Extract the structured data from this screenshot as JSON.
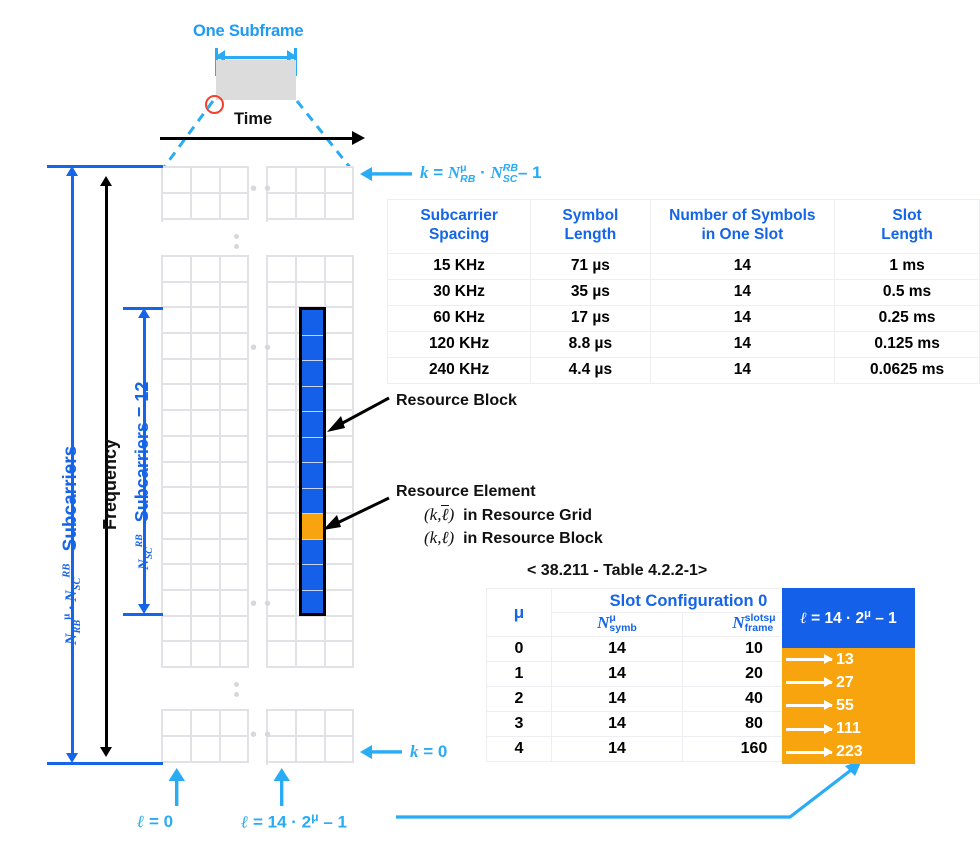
{
  "title": "5G NR Resource Grid / Resource Block / Resource Element diagram",
  "callout": {
    "one_subframe": "One Subframe",
    "time_axis_label": "Time",
    "marker": "red-circle-marker"
  },
  "axes": {
    "frequency_label": "Frequency",
    "k_top_label": "k = Nᴿᴮᵁ · Nₛᴄᴿᴮ – 1",
    "k_top_parts": {
      "lhs": "k = ",
      "n1": "N",
      "n1_sup": "μ",
      "n1_sub": "RB",
      "dot": "·",
      "n2": "N",
      "n2_sup": "RB",
      "n2_sub": "SC",
      "tail": "– 1"
    },
    "k_bottom_label": "k = 0",
    "l_left_label": "ℓ = 0",
    "l_right_label": "ℓ = 14 · 2μ – 1",
    "l_right_parts": {
      "lhs": "ℓ = 14 · 2",
      "sup": "μ",
      "tail": "– 1"
    },
    "total_subcarriers_label": "Subcarriers",
    "total_subcarriers_prefix": "Nᴿᴮᵁ · Nₛᴄᴿᴮ",
    "rb_subcarriers_label": "Subcarriers = 12",
    "rb_subcarriers_prefix": "Nₛᴄᴿᴮ"
  },
  "annotations": {
    "resource_block": "Resource Block",
    "resource_element": "Resource Element",
    "re_line1_coord": "(k,ℓ̅)",
    "re_line1_text": "in Resource Grid",
    "re_line2_coord": "(k,ℓ)",
    "re_line2_text": "in Resource Block"
  },
  "grid": {
    "resource_block_cells": 12,
    "highlighted_resource_element_index": 8,
    "block_cols": 3,
    "top_block_rows": 2,
    "middle_block_rows": 16,
    "bottom_block_rows": 2
  },
  "top_table": {
    "headers": [
      "Subcarrier\nSpacing",
      "Symbol\nLength",
      "Number of Symbols\nin One Slot",
      "Slot\nLength"
    ],
    "headers_l1": [
      "Subcarrier",
      "Symbol",
      "Number of Symbols",
      "Slot"
    ],
    "headers_l2": [
      "Spacing",
      "Length",
      "in One Slot",
      "Length"
    ],
    "rows": [
      [
        "15 KHz",
        "71 µs",
        "14",
        "1 ms"
      ],
      [
        "30 KHz",
        "35 µs",
        "14",
        "0.5 ms"
      ],
      [
        "60 KHz",
        "17 µs",
        "14",
        "0.25 ms"
      ],
      [
        "120 KHz",
        "8.8 µs",
        "14",
        "0.125 ms"
      ],
      [
        "240 KHz",
        "4.4 µs",
        "14",
        "0.0625 ms"
      ]
    ]
  },
  "bottom_table": {
    "caption": "< 38.211 - Table 4.2.2-1>",
    "mu_header": "μ",
    "group_header": "Slot Configuration 0",
    "sub_headers": [
      "Nₛᵧₘₕᵁ",
      "Nᶠʳᵃᵐᵉˢˡᵒᵗˢ μ"
    ],
    "sub_header_1": {
      "base": "N",
      "sub": "symb",
      "sup": "μ"
    },
    "sub_header_2": {
      "base": "N",
      "sub": "frame",
      "sup": "slots μ"
    },
    "ell_header": "ℓ = 14 · 2μ – 1",
    "ell_header_parts": {
      "lhs": "ℓ = 14 · 2",
      "sup": "μ",
      "tail": "– 1"
    },
    "rows": [
      {
        "mu": "0",
        "nsymb": "14",
        "nframe": "10",
        "ell": "13"
      },
      {
        "mu": "1",
        "nsymb": "14",
        "nframe": "20",
        "ell": "27"
      },
      {
        "mu": "2",
        "nsymb": "14",
        "nframe": "40",
        "ell": "55"
      },
      {
        "mu": "3",
        "nsymb": "14",
        "nframe": "80",
        "ell": "111"
      },
      {
        "mu": "4",
        "nsymb": "14",
        "nframe": "160",
        "ell": "223"
      }
    ]
  },
  "colors": {
    "accent_blue": "#1565e8",
    "light_blue": "#1d9bf5",
    "orange": "#f8a40e",
    "block_blue": "#1560e8",
    "grid_gray": "#e2e2e6",
    "subframe_gray": "#dcdcdc",
    "marker_red": "#f4402e",
    "black": "#000000",
    "white": "#ffffff"
  }
}
